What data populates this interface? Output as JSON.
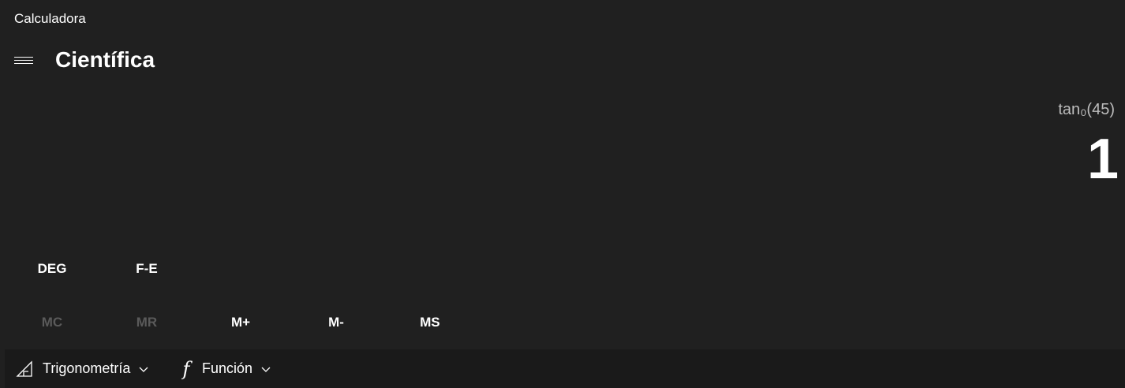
{
  "window": {
    "title": "Calculadora"
  },
  "header": {
    "mode_title": "Científica",
    "menu_icon": "hamburger-menu-icon"
  },
  "display": {
    "expression": "tan₀(45)",
    "result": "1"
  },
  "mode_buttons": [
    {
      "label": "DEG"
    },
    {
      "label": "F-E"
    }
  ],
  "memory_buttons": [
    {
      "label": "MC",
      "enabled": false
    },
    {
      "label": "MR",
      "enabled": false
    },
    {
      "label": "M+",
      "enabled": true
    },
    {
      "label": "M-",
      "enabled": true
    },
    {
      "label": "MS",
      "enabled": true
    }
  ],
  "toolbar": {
    "trig": {
      "label": "Trigonometría",
      "icon": "triangle-ruler-icon"
    },
    "func": {
      "label": "Función",
      "icon": "function-f-icon",
      "glyph": "f"
    }
  },
  "colors": {
    "background": "#202020",
    "toolbar_bg": "#1a1a1a",
    "text": "#ffffff",
    "secondary_text": "#bdbdbd",
    "disabled_text": "#5a5a5a"
  }
}
